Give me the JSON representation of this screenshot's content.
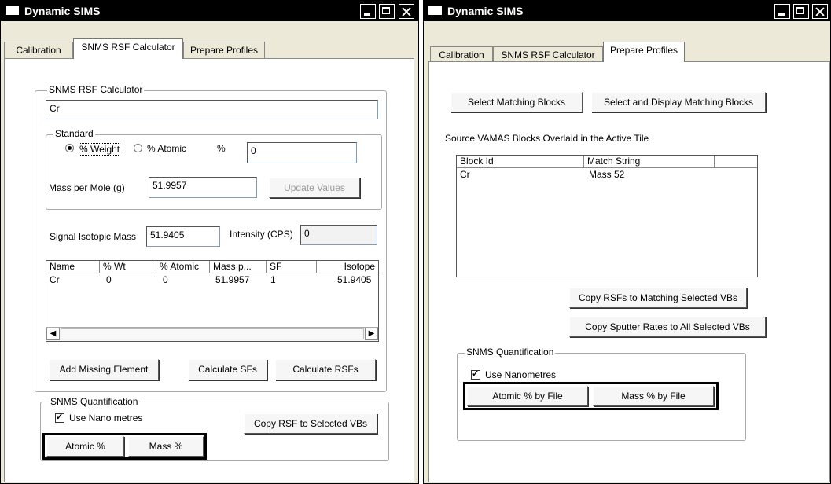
{
  "left_window": {
    "title": "Dynamic SIMS",
    "tabs": [
      "Calibration",
      "SNMS RSF Calculator",
      "Prepare Profiles"
    ],
    "active_tab": "SNMS RSF Calculator",
    "calculator_group": {
      "label": "SNMS RSF Calculator",
      "element_value": "Cr"
    },
    "standard_group": {
      "label": "Standard",
      "weight_radio": "% Weight",
      "atomic_radio": "% Atomic",
      "percent_label": "%",
      "percent_value": "0",
      "mass_per_mole_label": "Mass per Mole (g)",
      "mass_per_mole_value": "51.9957",
      "update_button": "Update Values"
    },
    "signal_isotopic_mass_label": "Signal Isotopic Mass",
    "signal_isotopic_mass_value": "51.9405",
    "intensity_label": "Intensity (CPS)",
    "intensity_value": "0",
    "table": {
      "headers": [
        "Name",
        "% Wt",
        "% Atomic",
        "Mass p...",
        "SF",
        "Isotope"
      ],
      "rows": [
        [
          "Cr",
          "0",
          "0",
          "51.9957",
          "1",
          "51.9405"
        ]
      ]
    },
    "buttons": {
      "add_missing": "Add Missing Element",
      "calc_sfs": "Calculate SFs",
      "calc_rsfs": "Calculate RSFs"
    },
    "quant_group": {
      "label": "SNMS Quantification",
      "use_nano": "Use Nano metres",
      "copy_rsf": "Copy RSF to Selected VBs",
      "atomic": "Atomic %",
      "mass": "Mass %"
    }
  },
  "right_window": {
    "title": "Dynamic SIMS",
    "tabs": [
      "Calibration",
      "SNMS RSF Calculator",
      "Prepare Profiles"
    ],
    "active_tab": "Prepare Profiles",
    "select_matching": "Select Matching Blocks",
    "select_display_matching": "Select and Display Matching Blocks",
    "source_label": "Source VAMAS Blocks Overlaid in the Active Tile",
    "table": {
      "headers": [
        "Block Id",
        "Match String"
      ],
      "rows": [
        [
          "Cr",
          "Mass 52"
        ]
      ]
    },
    "copy_rsfs": "Copy RSFs to Matching Selected VBs",
    "copy_sputter": "Copy Sputter Rates to All Selected VBs",
    "quant_group": {
      "label": "SNMS Quantification",
      "use_nano": "Use Nanometres",
      "atomic_by_file": "Atomic % by File",
      "mass_by_file": "Mass % by File"
    }
  }
}
